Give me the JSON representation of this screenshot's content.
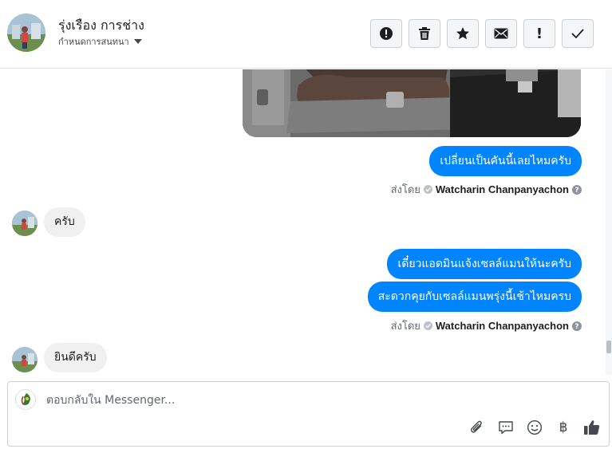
{
  "header": {
    "contact_name": "รุ่งเรือง การช่าง",
    "assign_label": "กำหนดการสนทนา",
    "toolbar": [
      {
        "name": "spam-button",
        "icon": "alert-circle-icon"
      },
      {
        "name": "delete-button",
        "icon": "trash-icon"
      },
      {
        "name": "star-button",
        "icon": "star-icon"
      },
      {
        "name": "unread-button",
        "icon": "envelope-icon"
      },
      {
        "name": "priority-button",
        "icon": "exclamation-icon",
        "glyph": "!"
      },
      {
        "name": "done-button",
        "icon": "check-icon"
      }
    ]
  },
  "messages": {
    "out_1": "เปลี่ยนเป็นคันนี้เลยไหมครับ",
    "in_1": "ครับ",
    "out_2": "เดี๋ยวแอดมินแจ้งเซลล์แมนให้นะครับ",
    "out_3": "สะดวกคุยกับเซลล์แมนพรุ่งนี้เช้าไหมครบ",
    "in_2": "ยินดีครับ",
    "sent_by_prefix": "ส่งโดย",
    "sender_name": "Watcharin Chanpanyachon"
  },
  "composer": {
    "placeholder": "ตอบกลับใน Messenger...",
    "baht_symbol": "฿"
  },
  "colors": {
    "outgoing_bubble": "#0084ff",
    "incoming_bubble": "#f1f0f0",
    "border": "#ccd0d5"
  }
}
